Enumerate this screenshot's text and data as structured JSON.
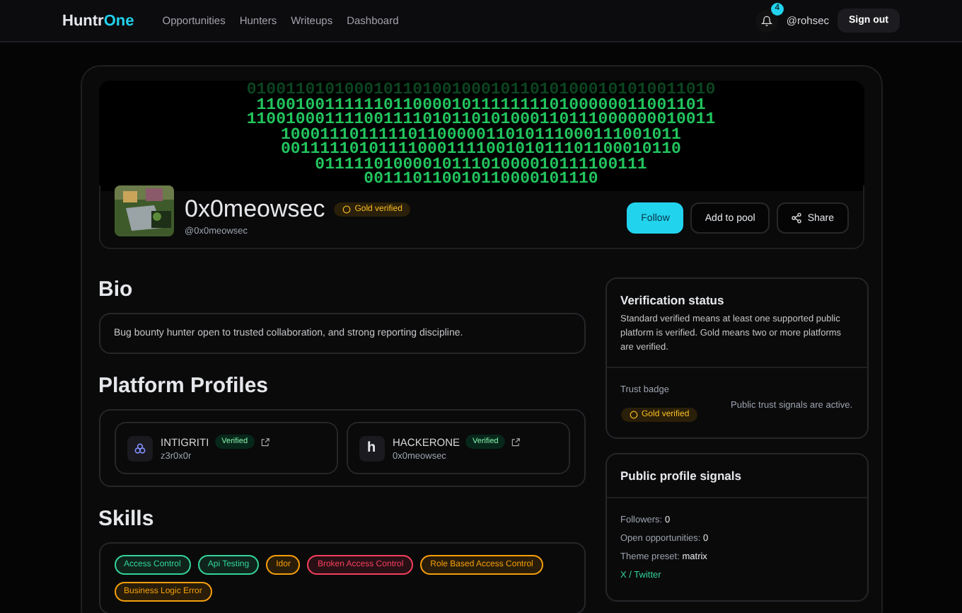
{
  "nav": {
    "brand": {
      "name": "Huntr",
      "accent": "One"
    },
    "links": [
      "Opportunities",
      "Hunters",
      "Writeups",
      "Dashboard"
    ],
    "notifications": "4",
    "user": "@rohsec",
    "signout": "Sign out"
  },
  "banner": [
    "010011010100010110100100010110101000101010011010",
    "1100100111111011000010111111110100000011001101",
    "110010001111001111010110101000110111000000010011",
    "10001110111110110000011010111000111001011",
    "00111110101111000111100101011101100010110",
    "0111110100001011101000010111100111",
    "001110110010110000101110"
  ],
  "profile": {
    "name": "0x0meowsec",
    "badge": "Gold verified",
    "handle": "@0x0meowsec",
    "buttons": [
      {
        "label": "Follow",
        "kind": "primary"
      },
      {
        "label": "Add to pool",
        "kind": "plain"
      },
      {
        "label": "Share",
        "kind": "share"
      }
    ]
  },
  "bio": {
    "title": "Bio",
    "text": "Bug bounty hunter open to trusted collaboration, and strong reporting discipline."
  },
  "platforms": {
    "title": "Platform Profiles",
    "items": [
      {
        "kind": "intigriti",
        "name": "INTIGRITI",
        "status": "Verified",
        "user": "z3r0x0r"
      },
      {
        "kind": "hackerone",
        "name": "HACKERONE",
        "status": "Verified",
        "user": "0x0meowsec",
        "glyph": "h"
      }
    ]
  },
  "skills": {
    "title": "Skills",
    "items": [
      {
        "label": "Access Control",
        "color": "#34d399"
      },
      {
        "label": "Api Testing",
        "color": "#34d399"
      },
      {
        "label": "Idor",
        "color": "#f59e0b"
      },
      {
        "label": "Broken Access Control",
        "color": "#f43f5e"
      },
      {
        "label": "Role Based Access Control",
        "color": "#f59e0b"
      },
      {
        "label": "Business Logic Error",
        "color": "#f59e0b"
      }
    ]
  },
  "verification": {
    "title": "Verification status",
    "text": "Standard verified means at least one supported public platform is verified. Gold means two or more platforms are verified.",
    "trust_label": "Trust badge",
    "badge": "Gold verified",
    "note": "Public trust signals are active."
  },
  "signals": {
    "title": "Public profile signals",
    "rows": [
      {
        "label": "Followers:",
        "value": "0"
      },
      {
        "label": "Open opportunities:",
        "value": "0"
      },
      {
        "label": "Theme preset:",
        "value": "matrix"
      }
    ],
    "link": "X / Twitter"
  }
}
